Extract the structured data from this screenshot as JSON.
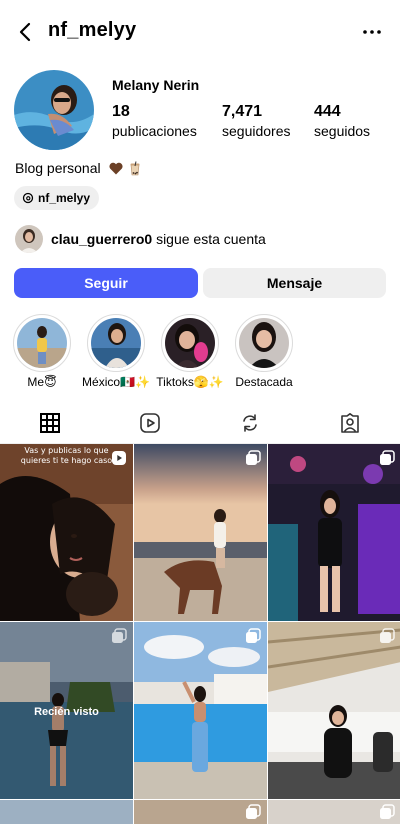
{
  "header": {
    "username": "nf_melyy",
    "back_icon": "chevron-left-icon",
    "more_icon": "more-horizontal-icon"
  },
  "profile": {
    "full_name": "Melany Nerin",
    "stats": {
      "posts": {
        "value": "18",
        "label": "publicaciones"
      },
      "followers": {
        "value": "7,471",
        "label": "seguidores"
      },
      "following": {
        "value": "444",
        "label": "seguidos"
      }
    },
    "bio": "Blog personal",
    "threads_handle": "nf_melyy",
    "followed_by": {
      "name": "clau_guerrero0",
      "text": "sigue esta cuenta"
    }
  },
  "actions": {
    "follow_label": "Seguir",
    "message_label": "Mensaje"
  },
  "highlights": [
    {
      "label": "Me😇"
    },
    {
      "label": "México🇲🇽✨"
    },
    {
      "label": "Tiktoks🫣✨"
    },
    {
      "label": "Destacada"
    }
  ],
  "tabs": [
    "grid",
    "reels",
    "reposts",
    "tagged"
  ],
  "grid": {
    "posts": [
      {
        "overlay": "Vas y publicas lo que quieres ti te hago caso",
        "type": "reel"
      },
      {
        "type": "carousel"
      },
      {
        "type": "carousel"
      },
      {
        "seen_label": "Recién visto",
        "type": "carousel"
      },
      {
        "type": "carousel"
      },
      {
        "type": "carousel"
      }
    ]
  },
  "colors": {
    "follow_button": "#4a5df9",
    "secondary_button": "#efefef"
  }
}
